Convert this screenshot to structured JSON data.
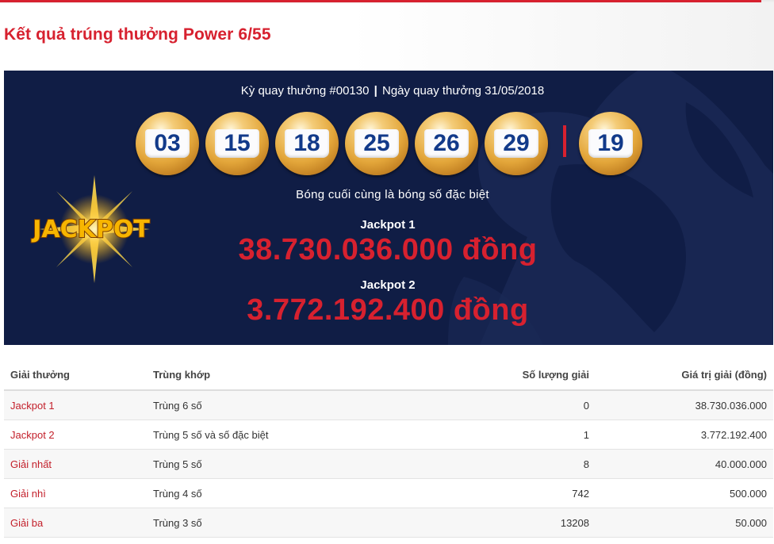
{
  "page": {
    "title": "Kết quả trúng thưởng Power 6/55"
  },
  "draw": {
    "period": "Kỳ quay thưởng #00130",
    "separator": "|",
    "date": "Ngày quay thưởng 31/05/2018",
    "numbers": [
      "03",
      "15",
      "18",
      "25",
      "26",
      "29"
    ],
    "special_number": "19",
    "special_note": "Bóng cuối cùng là bóng số đặc biệt",
    "logo_text": "JACKPOT"
  },
  "jackpots": [
    {
      "label": "Jackpot 1",
      "amount": "38.730.036.000 đồng"
    },
    {
      "label": "Jackpot 2",
      "amount": "3.772.192.400 đồng"
    }
  ],
  "table": {
    "headers": [
      "Giải thưởng",
      "Trùng khớp",
      "Số lượng giải",
      "Giá trị giải (đồng)"
    ],
    "rows": [
      [
        "Jackpot 1",
        "Trùng 6 số",
        "0",
        "38.730.036.000"
      ],
      [
        "Jackpot 2",
        "Trùng 5 số và số đặc biệt",
        "1",
        "3.772.192.400"
      ],
      [
        "Giải nhất",
        "Trùng 5 số",
        "8",
        "40.000.000"
      ],
      [
        "Giải nhì",
        "Trùng 4 số",
        "742",
        "500.000"
      ],
      [
        "Giải ba",
        "Trùng 3 số",
        "13208",
        "50.000"
      ]
    ]
  },
  "colors": {
    "accent_red": "#d7212f",
    "panel_navy": "#101d45",
    "ball_gold": "#e3a63a",
    "ball_number_blue": "#123a8a"
  }
}
